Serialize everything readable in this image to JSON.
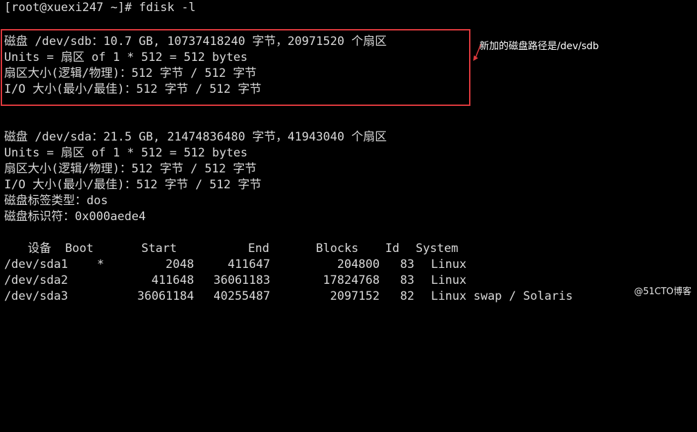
{
  "terminal": {
    "prompt": "[root@xuexi247 ~]# fdisk -l",
    "sdb": {
      "line1": "磁盘 /dev/sdb：10.7 GB, 10737418240 字节，20971520 个扇区",
      "line2": "Units = 扇区 of 1 * 512 = 512 bytes",
      "line3": "扇区大小(逻辑/物理)：512 字节 / 512 字节",
      "line4": "I/O 大小(最小/最佳)：512 字节 / 512 字节"
    },
    "sda": {
      "line1": "磁盘 /dev/sda：21.5 GB, 21474836480 字节，41943040 个扇区",
      "line2": "Units = 扇区 of 1 * 512 = 512 bytes",
      "line3": "扇区大小(逻辑/物理)：512 字节 / 512 字节",
      "line4": "I/O 大小(最小/最佳)：512 字节 / 512 字节",
      "line5": "磁盘标签类型：dos",
      "line6": "磁盘标识符：0x000aede4"
    },
    "partition_table": {
      "headers": {
        "device": "设备",
        "boot": "Boot",
        "start": "Start",
        "end": "End",
        "blocks": "Blocks",
        "id": "Id",
        "system": "System"
      },
      "rows": [
        {
          "device": "/dev/sda1",
          "boot": "*",
          "start": "2048",
          "end": "411647",
          "blocks": "204800",
          "id": "83",
          "system": "Linux"
        },
        {
          "device": "/dev/sda2",
          "boot": "",
          "start": "411648",
          "end": "36061183",
          "blocks": "17824768",
          "id": "83",
          "system": "Linux"
        },
        {
          "device": "/dev/sda3",
          "boot": "",
          "start": "36061184",
          "end": "40255487",
          "blocks": "2097152",
          "id": "82",
          "system": "Linux swap / Solaris"
        }
      ]
    }
  },
  "annotation": {
    "text": "新加的磁盘路径是/dev/sdb"
  },
  "watermark": {
    "text": "@51CTO博客"
  },
  "colors": {
    "background": "#000000",
    "text": "#d9d9d9",
    "highlight_border": "#e03a3e"
  }
}
